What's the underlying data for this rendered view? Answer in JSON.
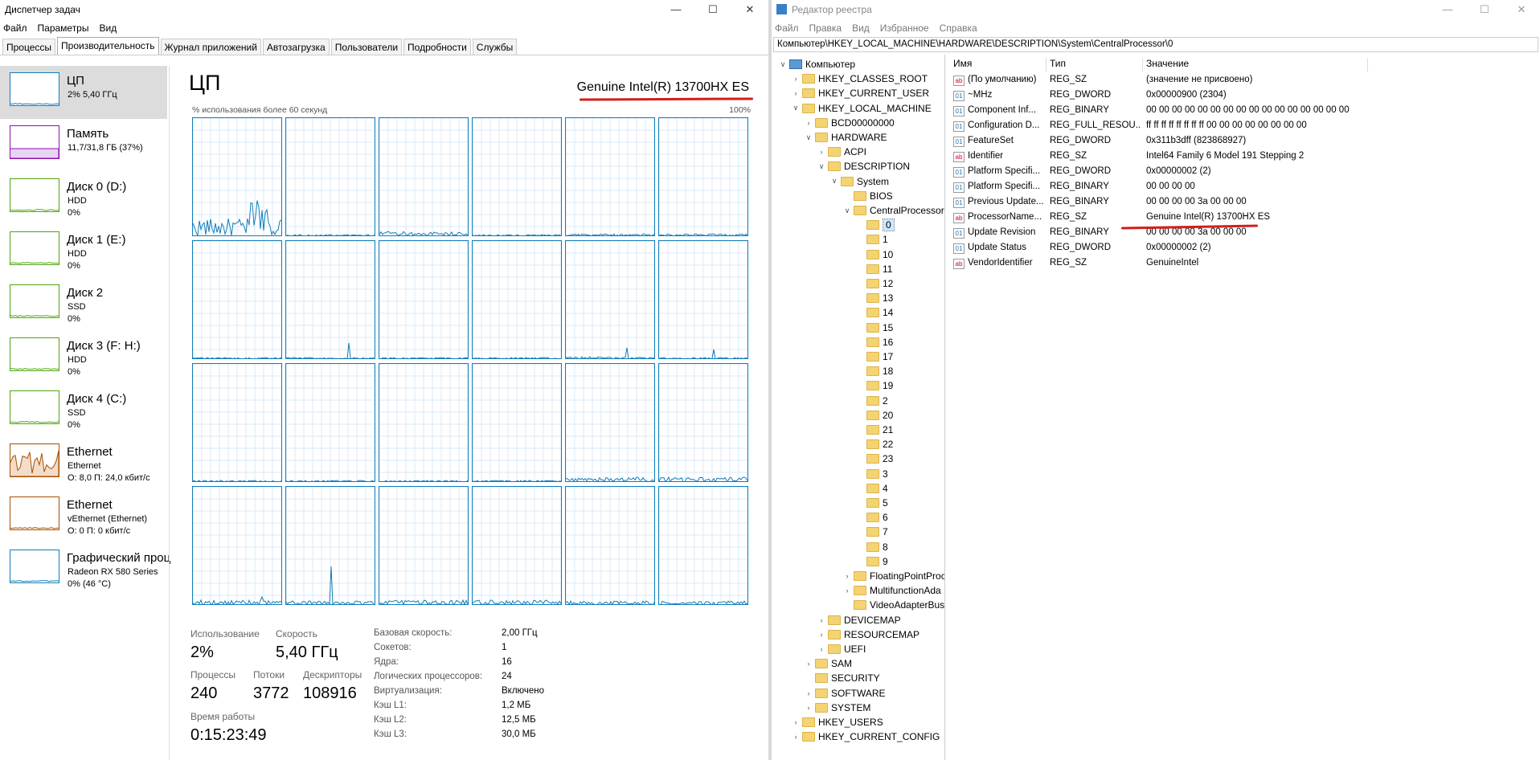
{
  "tm": {
    "title": "Диспетчер задач",
    "menu": [
      "Файл",
      "Параметры",
      "Вид"
    ],
    "tabs": [
      "Процессы",
      "Производительность",
      "Журнал приложений",
      "Автозагрузка",
      "Пользователи",
      "Подробности",
      "Службы"
    ],
    "side": [
      {
        "name": "ЦП",
        "sub": "2% 5,40 ГГц",
        "sub2": ""
      },
      {
        "name": "Память",
        "sub": "11,7/31,8 ГБ (37%)",
        "sub2": ""
      },
      {
        "name": "Диск 0 (D:)",
        "sub": "HDD",
        "sub2": "0%"
      },
      {
        "name": "Диск 1 (E:)",
        "sub": "HDD",
        "sub2": "0%"
      },
      {
        "name": "Диск 2",
        "sub": "SSD",
        "sub2": "0%"
      },
      {
        "name": "Диск 3 (F: H:)",
        "sub": "HDD",
        "sub2": "0%"
      },
      {
        "name": "Диск 4 (C:)",
        "sub": "SSD",
        "sub2": "0%"
      },
      {
        "name": "Ethernet",
        "sub": "Ethernet",
        "sub2": "О: 8,0 П: 24,0 кбит/с"
      },
      {
        "name": "Ethernet",
        "sub": "vEthernet (Ethernet)",
        "sub2": "О: 0 П: 0 кбит/с"
      },
      {
        "name": "Графический проц",
        "sub": "Radeon RX 580 Series",
        "sub2": "0% (46 °C)"
      }
    ],
    "cpu_title": "ЦП",
    "cpu_name": "Genuine Intel(R) 13700HX ES",
    "graph_label": "% использования более 60 секунд",
    "graph_max": "100%",
    "stats": {
      "usage_lbl": "Использование",
      "usage": "2%",
      "speed_lbl": "Скорость",
      "speed": "5,40 ГГц",
      "proc_lbl": "Процессы",
      "proc": "240",
      "threads_lbl": "Потоки",
      "threads": "3772",
      "handles_lbl": "Дескрипторы",
      "handles": "108916",
      "uptime_lbl": "Время работы",
      "uptime": "0:15:23:49"
    },
    "kv": [
      [
        "Базовая скорость:",
        "2,00 ГГц"
      ],
      [
        "Сокетов:",
        "1"
      ],
      [
        "Ядра:",
        "16"
      ],
      [
        "Логических процессоров:",
        "24"
      ],
      [
        "Виртуализация:",
        "Включено"
      ],
      [
        "Кэш L1:",
        "1,2 МБ"
      ],
      [
        "Кэш L2:",
        "12,5 МБ"
      ],
      [
        "Кэш L3:",
        "30,0 МБ"
      ]
    ]
  },
  "re": {
    "title": "Редактор реестра",
    "menu": [
      "Файл",
      "Правка",
      "Вид",
      "Избранное",
      "Справка"
    ],
    "address": "Компьютер\\HKEY_LOCAL_MACHINE\\HARDWARE\\DESCRIPTION\\System\\CentralProcessor\\0",
    "tree": [
      {
        "l": "Компьютер",
        "d": 0,
        "c": "v",
        "comp": true
      },
      {
        "l": "HKEY_CLASSES_ROOT",
        "d": 1,
        "c": ">"
      },
      {
        "l": "HKEY_CURRENT_USER",
        "d": 1,
        "c": ">"
      },
      {
        "l": "HKEY_LOCAL_MACHINE",
        "d": 1,
        "c": "v"
      },
      {
        "l": "BCD00000000",
        "d": 2,
        "c": ">"
      },
      {
        "l": "HARDWARE",
        "d": 2,
        "c": "v"
      },
      {
        "l": "ACPI",
        "d": 3,
        "c": ">"
      },
      {
        "l": "DESCRIPTION",
        "d": 3,
        "c": "v"
      },
      {
        "l": "System",
        "d": 4,
        "c": "v"
      },
      {
        "l": "BIOS",
        "d": 5,
        "c": ""
      },
      {
        "l": "CentralProcessor",
        "d": 5,
        "c": "v"
      },
      {
        "l": "0",
        "d": 6,
        "c": "",
        "sel": true
      },
      {
        "l": "1",
        "d": 6,
        "c": ""
      },
      {
        "l": "10",
        "d": 6,
        "c": ""
      },
      {
        "l": "11",
        "d": 6,
        "c": ""
      },
      {
        "l": "12",
        "d": 6,
        "c": ""
      },
      {
        "l": "13",
        "d": 6,
        "c": ""
      },
      {
        "l": "14",
        "d": 6,
        "c": ""
      },
      {
        "l": "15",
        "d": 6,
        "c": ""
      },
      {
        "l": "16",
        "d": 6,
        "c": ""
      },
      {
        "l": "17",
        "d": 6,
        "c": ""
      },
      {
        "l": "18",
        "d": 6,
        "c": ""
      },
      {
        "l": "19",
        "d": 6,
        "c": ""
      },
      {
        "l": "2",
        "d": 6,
        "c": ""
      },
      {
        "l": "20",
        "d": 6,
        "c": ""
      },
      {
        "l": "21",
        "d": 6,
        "c": ""
      },
      {
        "l": "22",
        "d": 6,
        "c": ""
      },
      {
        "l": "23",
        "d": 6,
        "c": ""
      },
      {
        "l": "3",
        "d": 6,
        "c": ""
      },
      {
        "l": "4",
        "d": 6,
        "c": ""
      },
      {
        "l": "5",
        "d": 6,
        "c": ""
      },
      {
        "l": "6",
        "d": 6,
        "c": ""
      },
      {
        "l": "7",
        "d": 6,
        "c": ""
      },
      {
        "l": "8",
        "d": 6,
        "c": ""
      },
      {
        "l": "9",
        "d": 6,
        "c": ""
      },
      {
        "l": "FloatingPointProc",
        "d": 5,
        "c": ">"
      },
      {
        "l": "MultifunctionAda",
        "d": 5,
        "c": ">"
      },
      {
        "l": "VideoAdapterBus",
        "d": 5,
        "c": ""
      },
      {
        "l": "DEVICEMAP",
        "d": 3,
        "c": ">"
      },
      {
        "l": "RESOURCEMAP",
        "d": 3,
        "c": ">"
      },
      {
        "l": "UEFI",
        "d": 3,
        "c": ">"
      },
      {
        "l": "SAM",
        "d": 2,
        "c": ">"
      },
      {
        "l": "SECURITY",
        "d": 2,
        "c": ""
      },
      {
        "l": "SOFTWARE",
        "d": 2,
        "c": ">"
      },
      {
        "l": "SYSTEM",
        "d": 2,
        "c": ">"
      },
      {
        "l": "HKEY_USERS",
        "d": 1,
        "c": ">"
      },
      {
        "l": "HKEY_CURRENT_CONFIG",
        "d": 1,
        "c": ">"
      }
    ],
    "cols": [
      "Имя",
      "Тип",
      "Значение"
    ],
    "rows": [
      {
        "n": "(По умолчанию)",
        "t": "REG_SZ",
        "v": "(значение не присвоено)",
        "k": "sz"
      },
      {
        "n": "~MHz",
        "t": "REG_DWORD",
        "v": "0x00000900 (2304)",
        "k": "bin"
      },
      {
        "n": "Component Inf...",
        "t": "REG_BINARY",
        "v": "00 00 00 00 00 00 00 00 00 00 00 00 00 00 00 00",
        "k": "bin"
      },
      {
        "n": "Configuration D...",
        "t": "REG_FULL_RESOU...",
        "v": "ff ff ff ff ff ff ff ff 00 00 00 00 00 00 00 00",
        "k": "bin"
      },
      {
        "n": "FeatureSet",
        "t": "REG_DWORD",
        "v": "0x311b3dff (823868927)",
        "k": "bin"
      },
      {
        "n": "Identifier",
        "t": "REG_SZ",
        "v": "Intel64 Family 6 Model 191 Stepping 2",
        "k": "sz"
      },
      {
        "n": "Platform Specifi...",
        "t": "REG_DWORD",
        "v": "0x00000002 (2)",
        "k": "bin"
      },
      {
        "n": "Platform Specifi...",
        "t": "REG_BINARY",
        "v": "00 00 00 00",
        "k": "bin"
      },
      {
        "n": "Previous Update...",
        "t": "REG_BINARY",
        "v": "00 00 00 00 3a 00 00 00",
        "k": "bin"
      },
      {
        "n": "ProcessorName...",
        "t": "REG_SZ",
        "v": "Genuine Intel(R) 13700HX ES",
        "k": "sz"
      },
      {
        "n": "Update Revision",
        "t": "REG_BINARY",
        "v": "00 00 00 00 3a 00 00 00",
        "k": "bin"
      },
      {
        "n": "Update Status",
        "t": "REG_DWORD",
        "v": "0x00000002 (2)",
        "k": "bin"
      },
      {
        "n": "VendorIdentifier",
        "t": "REG_SZ",
        "v": "GenuineIntel",
        "k": "sz"
      }
    ]
  },
  "colors": {
    "cpu": "#117dbb",
    "mem": "#8b12ae",
    "disk": "#4da60c",
    "net": "#a74f01",
    "gpu": "#117dbb",
    "highlight": "#d31d1d"
  }
}
